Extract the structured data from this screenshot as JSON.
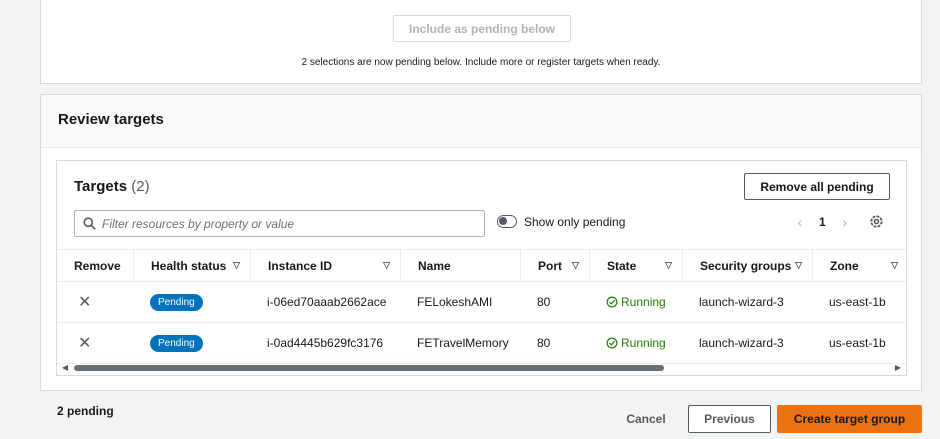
{
  "top_panel": {
    "cut_text": "  ...  (  ...  ) ",
    "include_button": "Include as pending below",
    "pending_note": "2 selections are now pending below. Include more or register targets when ready."
  },
  "review": {
    "title": "Review targets"
  },
  "targets": {
    "title": "Targets",
    "count": "(2)",
    "remove_all_button": "Remove all pending",
    "search_placeholder": "Filter resources by property or value",
    "toggle_label": "Show only pending",
    "page": "1",
    "columns": [
      "Remove",
      "Health status",
      "Instance ID",
      "Name",
      "Port",
      "State",
      "Security groups",
      "Zone"
    ],
    "rows": [
      {
        "health": "Pending",
        "instance_id": "i-06ed70aaab2662ace",
        "name": "FELokeshAMI",
        "port": "80",
        "state": "Running",
        "security_group": "launch-wizard-3",
        "zone": "us-east-1b"
      },
      {
        "health": "Pending",
        "instance_id": "i-0ad4445b629fc3176",
        "name": "FETravelMemory",
        "port": "80",
        "state": "Running",
        "security_group": "launch-wizard-3",
        "zone": "us-east-1b"
      }
    ]
  },
  "footer": {
    "pending_count": "2 pending",
    "cancel": "Cancel",
    "previous": "Previous",
    "create": "Create target group"
  },
  "colors": {
    "accent": "#ec7211",
    "badge": "#0073bb",
    "running": "#1d8102"
  },
  "icons": [
    "search-icon",
    "close-icon",
    "check-circle-icon",
    "gear-icon",
    "chevron-left-icon",
    "chevron-right-icon",
    "sort-icon"
  ]
}
